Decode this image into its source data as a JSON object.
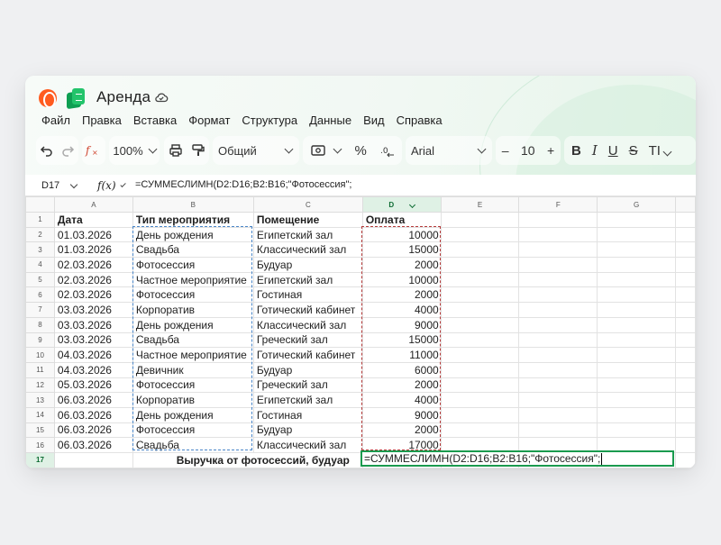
{
  "app": {
    "title": "Аренда",
    "menu": [
      "Файл",
      "Правка",
      "Вставка",
      "Формат",
      "Структура",
      "Данные",
      "Вид",
      "Справка"
    ]
  },
  "toolbar": {
    "zoom": "100%",
    "number_format": "Общий",
    "font_name": "Arial",
    "font_size": "10",
    "bold": "B",
    "italic": "I",
    "underline": "U",
    "strike": "S",
    "text_size": "TI"
  },
  "formula_bar": {
    "cell_ref": "D17",
    "fx": "f(x)",
    "formula": "=СУММЕСЛИМН(D2:D16;B2:B16;\"Фотосессия\";"
  },
  "sheet": {
    "columns": [
      "A",
      "B",
      "C",
      "D",
      "E",
      "F",
      "G"
    ],
    "active_column": "D",
    "active_row": 17,
    "headers": [
      "Дата",
      "Тип мероприятия",
      "Помещение",
      "Оплата"
    ],
    "rows": [
      {
        "n": 2,
        "date": "01.03.2026",
        "type": "День рождения",
        "room": "Египетский зал",
        "pay": 10000
      },
      {
        "n": 3,
        "date": "01.03.2026",
        "type": "Свадьба",
        "room": "Классический зал",
        "pay": 15000
      },
      {
        "n": 4,
        "date": "02.03.2026",
        "type": "Фотосессия",
        "room": "Будуар",
        "pay": 2000
      },
      {
        "n": 5,
        "date": "02.03.2026",
        "type": "Частное мероприятие",
        "room": "Египетский зал",
        "pay": 10000
      },
      {
        "n": 6,
        "date": "02.03.2026",
        "type": "Фотосессия",
        "room": "Гостиная",
        "pay": 2000
      },
      {
        "n": 7,
        "date": "03.03.2026",
        "type": "Корпоратив",
        "room": "Готический кабинет",
        "pay": 4000
      },
      {
        "n": 8,
        "date": "03.03.2026",
        "type": "День рождения",
        "room": "Классический зал",
        "pay": 9000
      },
      {
        "n": 9,
        "date": "03.03.2026",
        "type": "Свадьба",
        "room": "Греческий зал",
        "pay": 15000
      },
      {
        "n": 10,
        "date": "04.03.2026",
        "type": "Частное мероприятие",
        "room": "Готический кабинет",
        "pay": 11000
      },
      {
        "n": 11,
        "date": "04.03.2026",
        "type": "Девичник",
        "room": "Будуар",
        "pay": 6000
      },
      {
        "n": 12,
        "date": "05.03.2026",
        "type": "Фотосессия",
        "room": "Греческий зал",
        "pay": 2000
      },
      {
        "n": 13,
        "date": "06.03.2026",
        "type": "Корпоратив",
        "room": "Египетский зал",
        "pay": 4000
      },
      {
        "n": 14,
        "date": "06.03.2026",
        "type": "День рождения",
        "room": "Гостиная",
        "pay": 9000
      },
      {
        "n": 15,
        "date": "06.03.2026",
        "type": "Фотосессия",
        "room": "Будуар",
        "pay": 2000
      },
      {
        "n": 16,
        "date": "06.03.2026",
        "type": "Свадьба",
        "room": "Классический зал",
        "pay": 17000
      }
    ],
    "row17_label": "Выручка от фотосессий, будуар",
    "row17_edit": "=СУММЕСЛИМН(D2:D16;B2:B16;\"Фотосессия\";"
  },
  "colors": {
    "accent_green": "#1a9a4e",
    "range_blue": "#4a86c8",
    "range_red": "#b53b3b"
  }
}
